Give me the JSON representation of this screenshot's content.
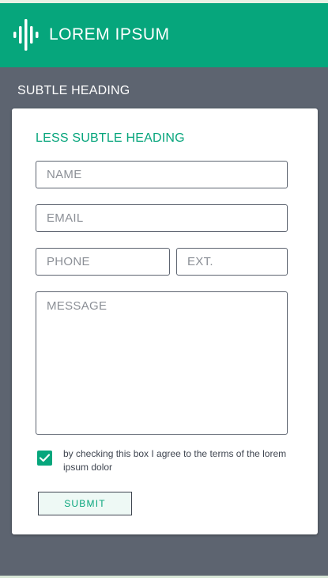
{
  "header": {
    "brand": "LOREM IPSUM",
    "logo_icon": "soundwave-bars-icon",
    "background": "#06a67c"
  },
  "section": {
    "subtle_heading": "SUBTLE HEADING",
    "background": "#5d6470"
  },
  "form": {
    "heading": "LESS SUBTLE HEADING",
    "accent": "#07a57c",
    "fields": {
      "name_placeholder": "NAME",
      "email_placeholder": "EMAIL",
      "phone_placeholder": "PHONE",
      "ext_placeholder": "EXT.",
      "message_placeholder": "MESSAGE"
    },
    "consent": {
      "checked": true,
      "text": "by checking this box I agree to the terms of the lorem ipsum dolor",
      "icon": "checkmark-icon"
    },
    "submit_label": "SUBMIT"
  }
}
